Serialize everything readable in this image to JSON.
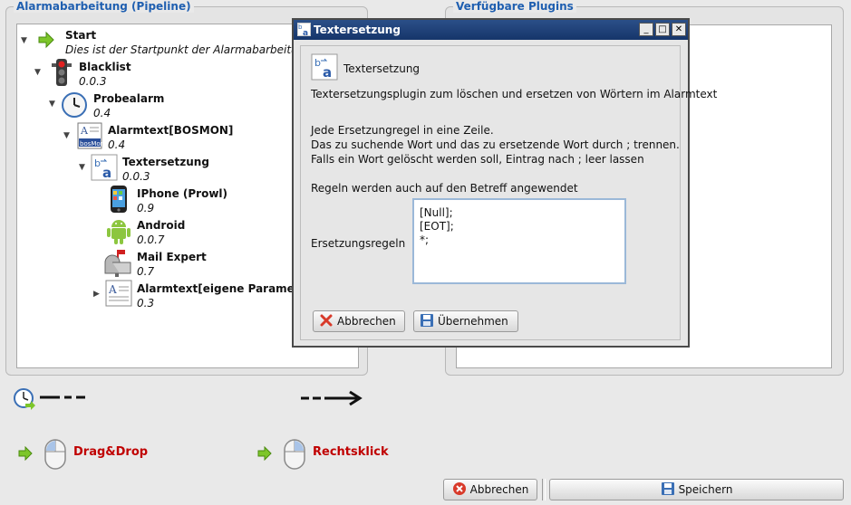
{
  "pipeline_panel": {
    "title": "Alarmabarbeitung (Pipeline)",
    "nodes": [
      {
        "name": "Start",
        "sub": "Dies ist der Startpunkt der Alarmabarbeitung",
        "icon": "green-arrow-icon"
      },
      {
        "name": "Blacklist",
        "sub": "0.0.3",
        "icon": "traffic-light-icon"
      },
      {
        "name": "Probealarm",
        "sub": "0.4",
        "icon": "clock-icon"
      },
      {
        "name": "Alarmtext[BOSMON]",
        "sub": "0.4",
        "icon": "bosmon-document-icon"
      },
      {
        "name": "Textersetzung",
        "sub": "0.0.3",
        "icon": "text-replace-icon"
      },
      {
        "name": "IPhone (Prowl)",
        "sub": "0.9",
        "icon": "iphone-icon"
      },
      {
        "name": "Android",
        "sub": "0.0.7",
        "icon": "android-icon"
      },
      {
        "name": "Mail Expert",
        "sub": "0.7",
        "icon": "mailbox-icon"
      },
      {
        "name": "Alarmtext[eigene Parameter]",
        "sub": "0.3",
        "icon": "document-icon"
      }
    ]
  },
  "plugins_panel": {
    "title": "Verfügbare Plugins"
  },
  "dialog": {
    "title": "Textersetzung",
    "header": "Textersetzung",
    "description": "Textersetzungsplugin zum löschen und ersetzen von Wörtern im Alarmtext",
    "instructions": [
      "Jede Ersetzungregel in eine Zeile.",
      "Das zu suchende Wort und das zu ersetzende Wort durch ; trennen.",
      "Falls ein Wort gelöscht werden soll, Eintrag nach ; leer lassen"
    ],
    "note": "Regeln werden auch auf den Betreff angewendet",
    "rules_label": "Ersetzungsregeln",
    "rules": [
      "[Null];",
      "[EOT];",
      "*;"
    ],
    "cancel_label": "Abbrechen",
    "apply_label": "Übernehmen"
  },
  "legend": {
    "dragdrop_label": "Drag&Drop",
    "rightclick_label": "Rechtsklick"
  },
  "footer": {
    "cancel_label": "Abbrechen",
    "save_label": "Speichern"
  },
  "colors": {
    "accent": "#1f5fb0",
    "hint": "#c00000",
    "titlebar": "#1e3f78"
  }
}
